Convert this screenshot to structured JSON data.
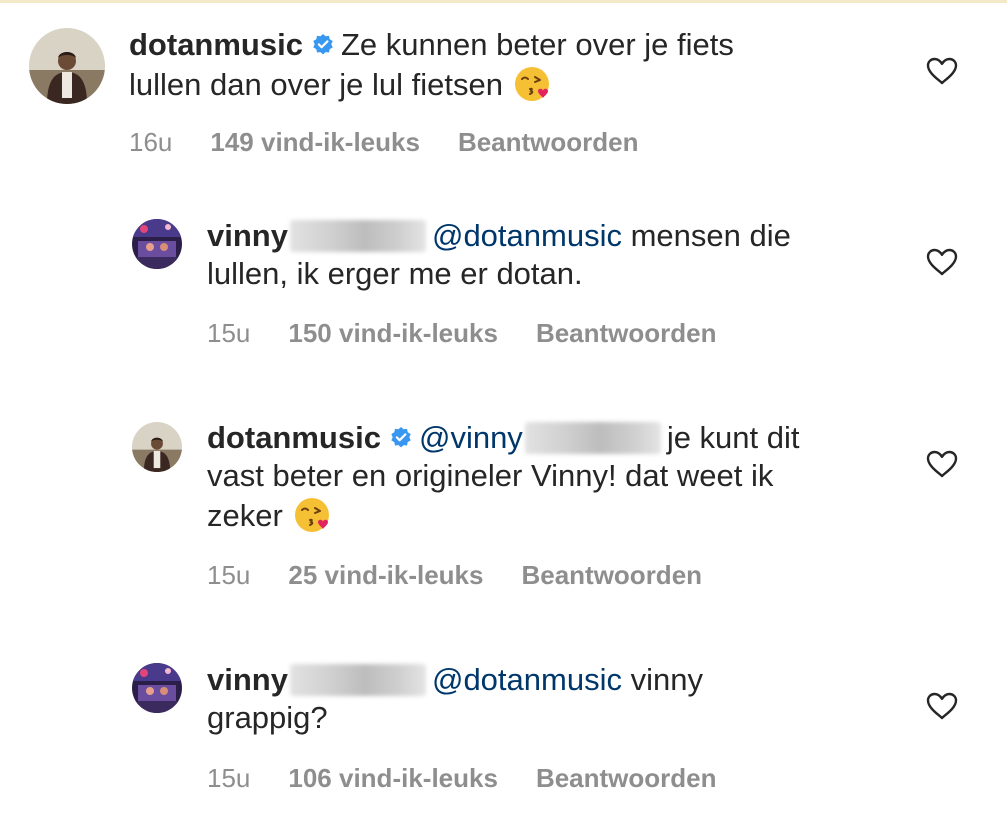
{
  "comments": [
    {
      "username": "dotanmusic",
      "verified": true,
      "mention": "",
      "text_line1": "Ze kunnen beter over je fiets",
      "text_line2": "lullen dan over je lul fietsen",
      "text_line3": "",
      "emoji": "kissing-face-with-heart-emoji",
      "time": "16u",
      "likes": "149 vind-ik-leuks",
      "reply": "Beantwoorden"
    },
    {
      "username": "vinny",
      "verified": false,
      "mention": "@dotanmusic",
      "text_line1": "mensen die",
      "text_line2": "lullen, ik erger me er dotan.",
      "text_line3": "",
      "time": "15u",
      "likes": "150 vind-ik-leuks",
      "reply": "Beantwoorden"
    },
    {
      "username": "dotanmusic",
      "verified": true,
      "mention": "@vinny",
      "text_line1": "je kunt dit",
      "text_line2": "vast beter en origineler Vinny! dat weet ik",
      "text_line3": "zeker",
      "emoji": "kissing-face-with-heart-emoji",
      "time": "15u",
      "likes": "25 vind-ik-leuks",
      "reply": "Beantwoorden"
    },
    {
      "username": "vinny",
      "verified": false,
      "mention": "@dotanmusic",
      "text_line1": "vinny",
      "text_line2": "grappig?",
      "text_line3": "",
      "time": "15u",
      "likes": "106 vind-ik-leuks",
      "reply": "Beantwoorden"
    }
  ],
  "colors": {
    "text": "#262626",
    "mention": "#00376b",
    "meta": "#8e8e8e",
    "verified": "#3897f0"
  }
}
